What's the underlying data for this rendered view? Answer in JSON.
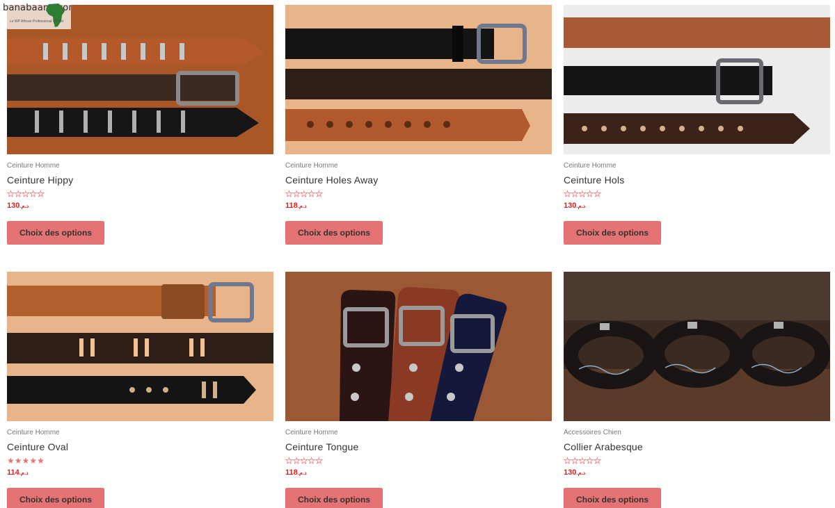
{
  "brand": {
    "name": "banabaana.com",
    "tagline": "Le WP African Professional Market"
  },
  "button_label": "Choix des options",
  "currency": "د.م.",
  "products": [
    {
      "category": "Ceinture Homme",
      "title": "Ceinture Hippy",
      "price": "130",
      "rating": 0
    },
    {
      "category": "Ceinture Homme",
      "title": "Ceinture Holes Away",
      "price": "118",
      "rating": 0
    },
    {
      "category": "Ceinture Homme",
      "title": "Ceinture Hols",
      "price": "130",
      "rating": 0
    },
    {
      "category": "Ceinture Homme",
      "title": "Ceinture Oval",
      "price": "114",
      "rating": 5
    },
    {
      "category": "Ceinture Homme",
      "title": "Ceinture Tongue",
      "price": "118",
      "rating": 0
    },
    {
      "category": "Accessoires Chien",
      "title": "Collier Arabesque",
      "price": "130",
      "rating": 0
    }
  ],
  "colors": {
    "accent": "#e57373",
    "price": "#e01f1f"
  }
}
